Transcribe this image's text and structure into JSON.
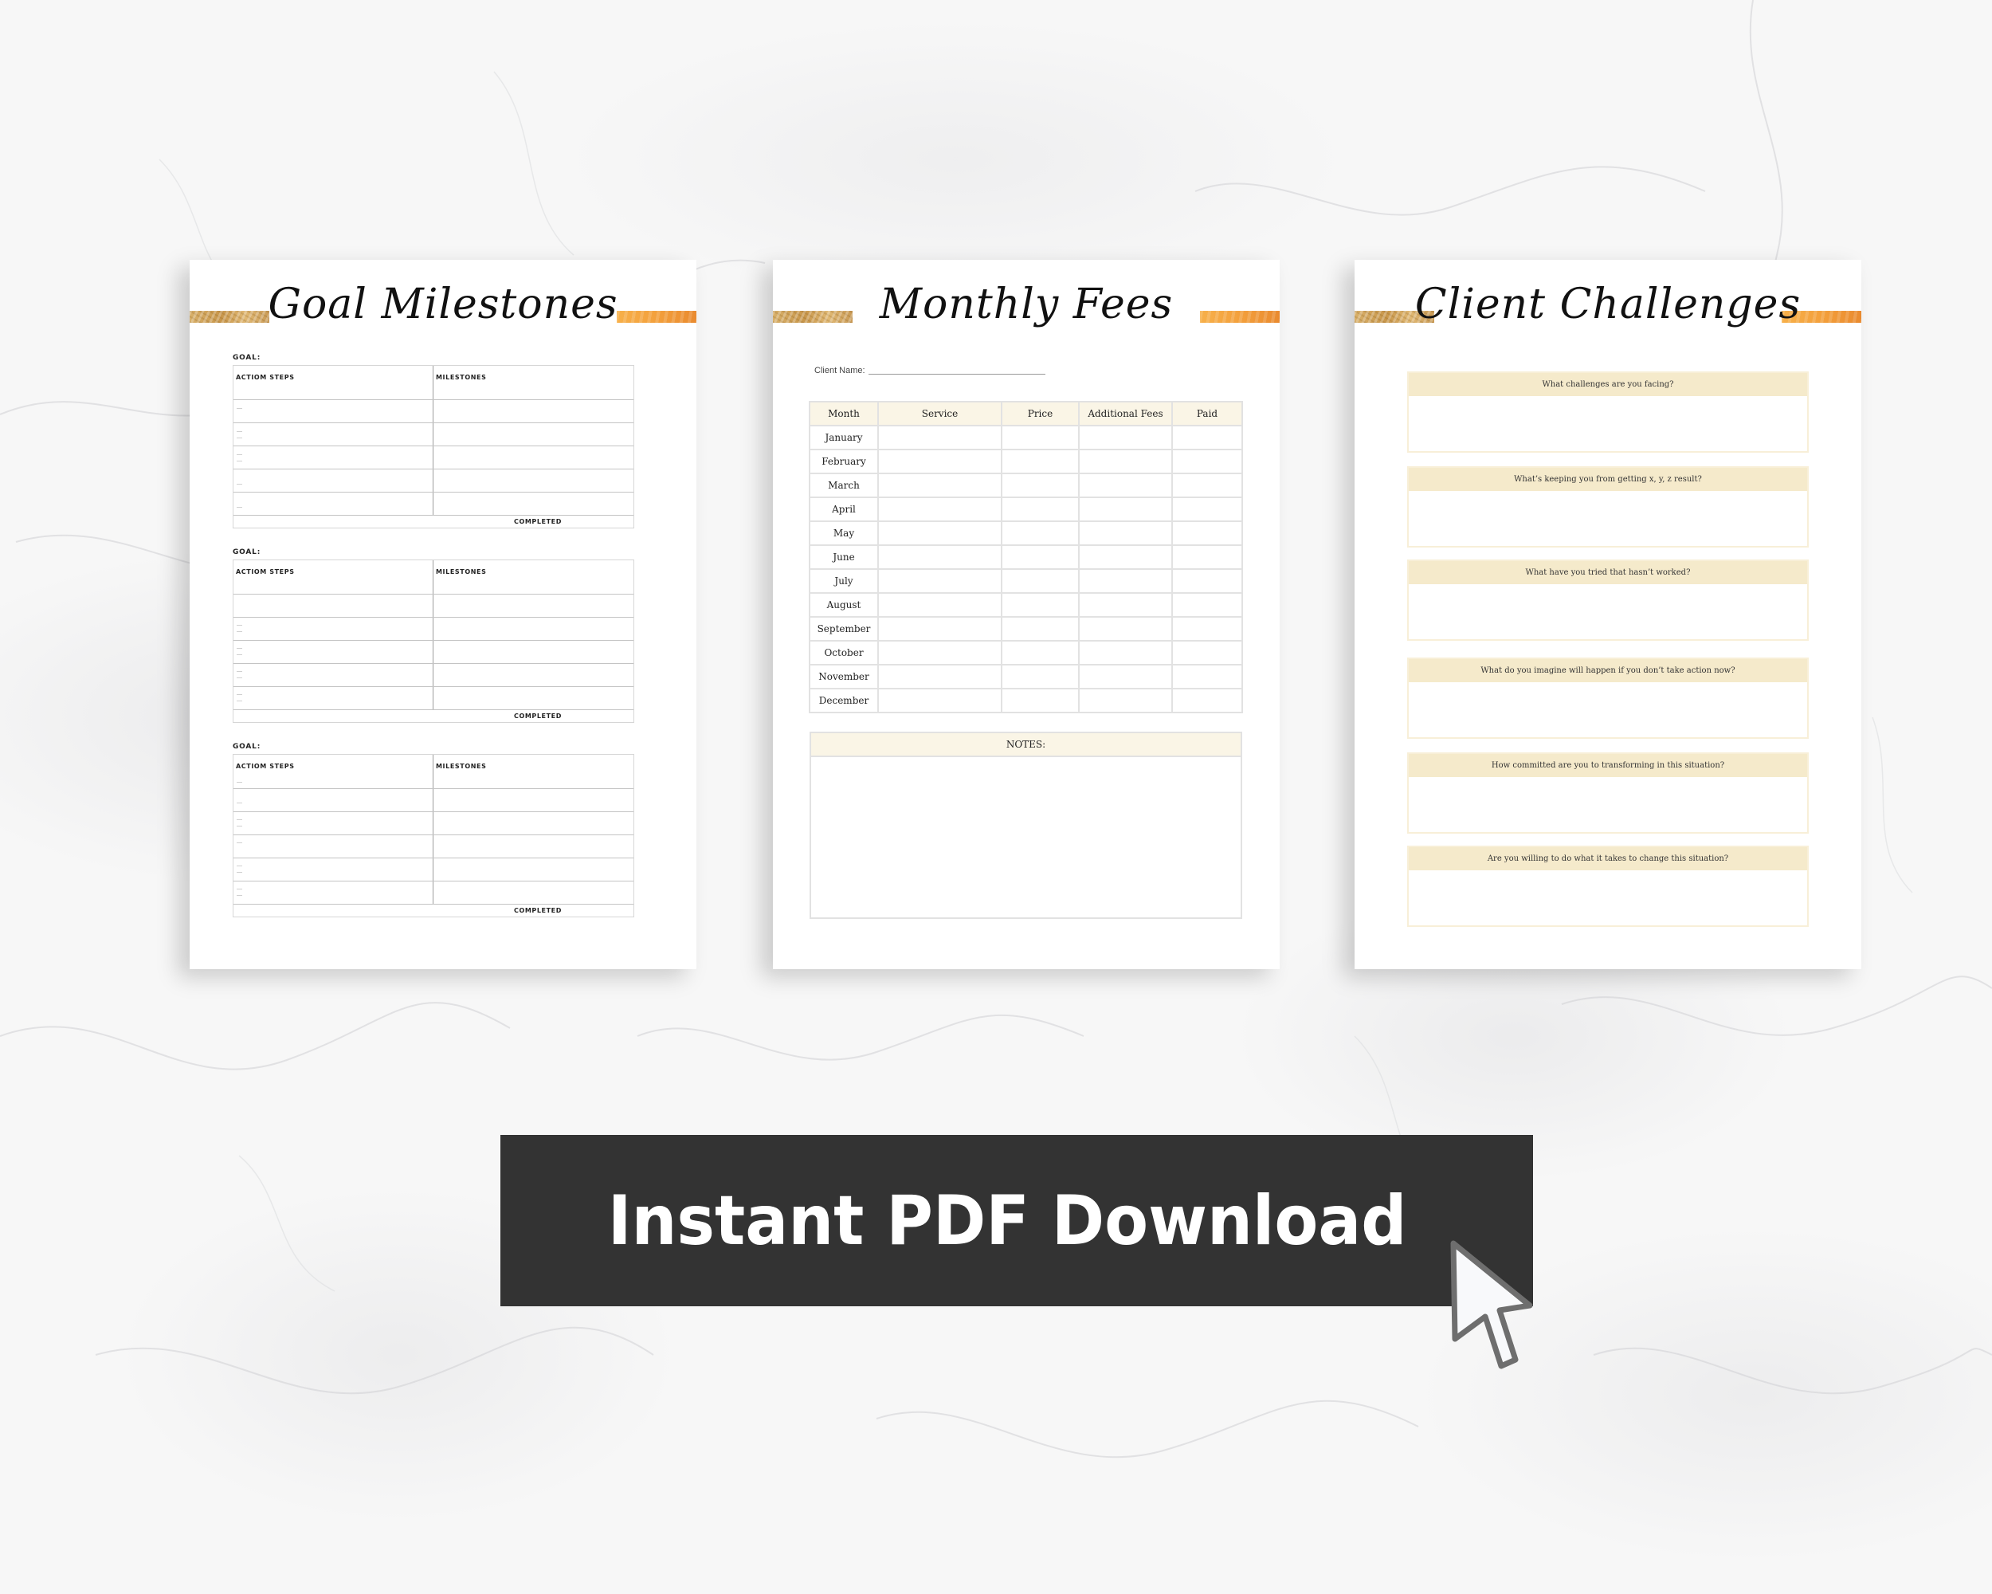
{
  "pages": {
    "goal_milestones": {
      "title": "Goal Milestones",
      "blocks": [
        {
          "goal_label": "GOAL:",
          "col_action": "ACTIOM STEPS",
          "col_milestones": "MILESTONES",
          "completed_label": "COMPLETED"
        },
        {
          "goal_label": "GOAL:",
          "col_action": "ACTIOM STEPS",
          "col_milestones": "MILESTONES",
          "completed_label": "COMPLETED"
        },
        {
          "goal_label": "GOAL:",
          "col_action": "ACTIOM STEPS",
          "col_milestones": "MILESTONES",
          "completed_label": "COMPLETED"
        }
      ]
    },
    "monthly_fees": {
      "title": "Monthly Fees",
      "client_name_label": "Client Name:",
      "columns": [
        "Month",
        "Service",
        "Price",
        "Additional Fees",
        "Paid"
      ],
      "months": [
        "January",
        "February",
        "March",
        "April",
        "May",
        "June",
        "July",
        "August",
        "September",
        "October",
        "November",
        "December"
      ],
      "notes_label": "NOTES:"
    },
    "client_challenges": {
      "title": "Client Challenges",
      "questions": [
        "What challenges are you facing?",
        "What’s keeping you from getting x, y, z result?",
        "What have you tried that hasn’t worked?",
        "What do you imagine will happen if you don’t take action now?",
        "How committed are you to transforming in this situation?",
        "Are you willing to do what it takes to change this situation?"
      ]
    }
  },
  "cta": {
    "label": "Instant PDF Download",
    "icon": "cursor-arrow-icon"
  },
  "colors": {
    "cta_background": "#333333",
    "cta_text": "#ffffff",
    "header_cream": "#faf5e6",
    "question_header": "#f5eacb",
    "foil_gold": "#d8b06a",
    "foil_orange": "#f3a03c",
    "background_marble": "#f7f7f7"
  }
}
